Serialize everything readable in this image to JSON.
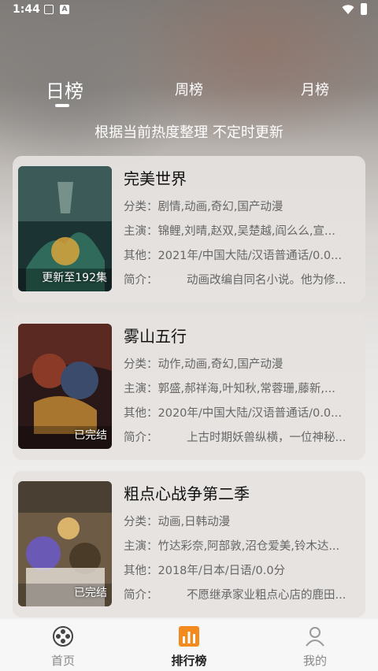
{
  "status_bar": {
    "time": "1:44"
  },
  "tabs": [
    {
      "label": "日榜",
      "active": true
    },
    {
      "label": "周榜",
      "active": false
    },
    {
      "label": "月榜",
      "active": false
    }
  ],
  "subtitle": "根据当前热度整理 不定时更新",
  "labels": {
    "category": "分类：",
    "cast": "主演：",
    "other": "其他：",
    "intro": "简介："
  },
  "items": [
    {
      "title": "完美世界",
      "badge": "更新至192集",
      "category": "剧情,动画,奇幻,国产动漫",
      "cast": "锦鲤,刘晴,赵双,吴楚越,阎么么,宣...",
      "other": "2021年/中国大陆/汉语普通话/0.0...",
      "intro": "动画改编自同名小说。他为修...",
      "colors": [
        "#1e3a3a",
        "#3d6b5e",
        "#c59b3f"
      ]
    },
    {
      "title": "雾山五行",
      "badge": "已完结",
      "category": "动作,动画,奇幻,国产动漫",
      "cast": "郭盛,郝祥海,叶知秋,常蓉珊,藤新,...",
      "other": "2020年/中国大陆/汉语普通话/0.0...",
      "intro": "上古时期妖兽纵横，一位神秘...",
      "colors": [
        "#2b1a1a",
        "#7a2b1f",
        "#d9a640"
      ]
    },
    {
      "title": "粗点心战争第二季",
      "badge": "已完结",
      "category": "动画,日韩动漫",
      "cast": "竹达彩奈,阿部敦,沼仓爱美,铃木达...",
      "other": "2018年/日本/日语/0.0分",
      "intro": "不愿继承家业粗点心店的鹿田...",
      "colors": [
        "#6b5a44",
        "#a7c2cf",
        "#5a4aa0"
      ]
    }
  ],
  "bottom_nav": [
    {
      "label": "首页",
      "icon": "film-reel-icon",
      "active": false
    },
    {
      "label": "排行榜",
      "icon": "ranking-chart-icon",
      "active": true
    },
    {
      "label": "我的",
      "icon": "user-icon",
      "active": false
    }
  ],
  "accent_color": "#f28a1e"
}
